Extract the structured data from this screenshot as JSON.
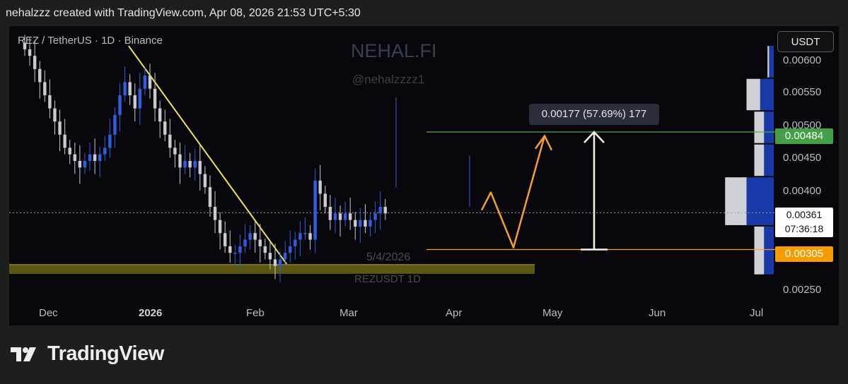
{
  "header": {
    "text": "nehalzzz created with TradingView.com, Apr 08, 2026 21:53 UTC+5:30"
  },
  "chart": {
    "pair_label": "REZ / TetherUS · 1D · Binance",
    "watermark_title": "NEHAL.FI",
    "watermark_sub": "@nehalzzzz1",
    "measure_label": "0.00177 (57.69%) 177",
    "currency": "USDT",
    "background_watermark_date": "5/4/2026",
    "background_watermark_symbol": "REZUSDT 1D"
  },
  "chart_data": {
    "type": "candlestick",
    "title": "REZ / TetherUS · 1D · Binance",
    "x_ticks": [
      "Dec",
      "2026",
      "Feb",
      "Mar",
      "Apr",
      "May",
      "Jun",
      "Jul"
    ],
    "y_ticks": [
      "0.00600",
      "0.00550",
      "0.00500",
      "0.00450",
      "0.00400",
      "0.00250"
    ],
    "ylim": [
      0.0023,
      0.0062
    ],
    "current_price": "0.00361",
    "countdown": "07:36:18",
    "target_price": "0.00484",
    "support_price": "0.00305",
    "measure": {
      "from": 0.00305,
      "to": 0.00484,
      "label": "0.00177 (57.69%) 177"
    },
    "closes": [
      0.0061,
      0.006,
      0.0058,
      0.0056,
      0.0054,
      0.0052,
      0.005,
      0.0048,
      0.0046,
      0.0045,
      0.0044,
      0.0043,
      0.0044,
      0.0045,
      0.0044,
      0.0045,
      0.0046,
      0.0048,
      0.0051,
      0.0054,
      0.0056,
      0.0054,
      0.0052,
      0.0055,
      0.0057,
      0.0055,
      0.0052,
      0.005,
      0.0048,
      0.0046,
      0.0045,
      0.0043,
      0.0044,
      0.0043,
      0.0044,
      0.0042,
      0.004,
      0.0037,
      0.0035,
      0.0033,
      0.0031,
      0.003,
      0.003,
      0.0031,
      0.0032,
      0.0033,
      0.0032,
      0.0031,
      0.003,
      0.0029,
      0.0028,
      0.0029,
      0.003,
      0.0031,
      0.0032,
      0.0033,
      0.0033,
      0.0032,
      0.0041,
      0.0039,
      0.0037,
      0.0035,
      0.0036,
      0.0035,
      0.0036,
      0.0035,
      0.0034,
      0.0035,
      0.0034,
      0.0035,
      0.0036,
      0.0037,
      0.0036
    ],
    "trendline": {
      "from": {
        "date": "2025-12-25",
        "price": 0.00615
      },
      "to": {
        "date": "2026-02-10",
        "price": 0.00283
      }
    },
    "support_zone": [
      0.00268,
      0.00282
    ],
    "projection_path": [
      0.00365,
      0.00392,
      0.00308,
      0.00478
    ],
    "volume_profile": [
      {
        "price_from": 0.00565,
        "price_to": 0.00615,
        "buy": 0.12,
        "sell": 0.04
      },
      {
        "price_from": 0.00515,
        "price_to": 0.00565,
        "buy": 0.35,
        "sell": 0.35
      },
      {
        "price_from": 0.00465,
        "price_to": 0.00515,
        "buy": 0.25,
        "sell": 0.25
      },
      {
        "price_from": 0.00415,
        "price_to": 0.00465,
        "buy": 0.25,
        "sell": 0.25
      },
      {
        "price_from": 0.0034,
        "price_to": 0.00415,
        "buy": 0.7,
        "sell": 0.55
      },
      {
        "price_from": 0.00265,
        "price_to": 0.0034,
        "buy": 0.25,
        "sell": 0.25
      }
    ],
    "colors": {
      "up": "#2f5fe0",
      "down": "#c9cbd1",
      "trendline": "#f3e35a",
      "projection": "#f5a030",
      "target_line": "#4caf50",
      "support_line": "#f5a030",
      "target_tag": "#43a047",
      "support_tag": "#f59c00"
    }
  },
  "footer": {
    "brand": "TradingView"
  }
}
